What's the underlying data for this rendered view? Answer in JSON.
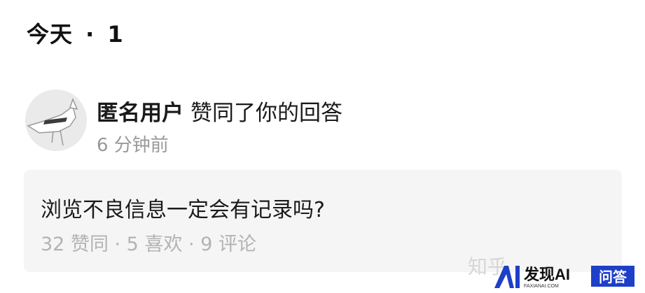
{
  "section": {
    "day": "今天",
    "separator": "·",
    "count": "1"
  },
  "notification": {
    "avatar_icon": "anonymous-cat-avatar",
    "user": "匿名用户",
    "action": "赞同了你的回答",
    "time": "6 分钟前"
  },
  "card": {
    "title": "浏览不良信息一定会有记录吗?",
    "stats": "32 赞同 · 5 喜欢 · 9 评论"
  },
  "watermark": {
    "platform_text": "知乎",
    "logo_text": "发现AI",
    "logo_subtext": "FAXIANAI.COM",
    "badge_text": "问答"
  },
  "colors": {
    "text_primary": "#1a1a1a",
    "text_secondary": "#999999",
    "card_bg": "#f5f5f5",
    "logo_blue": "#1e3fc8"
  }
}
